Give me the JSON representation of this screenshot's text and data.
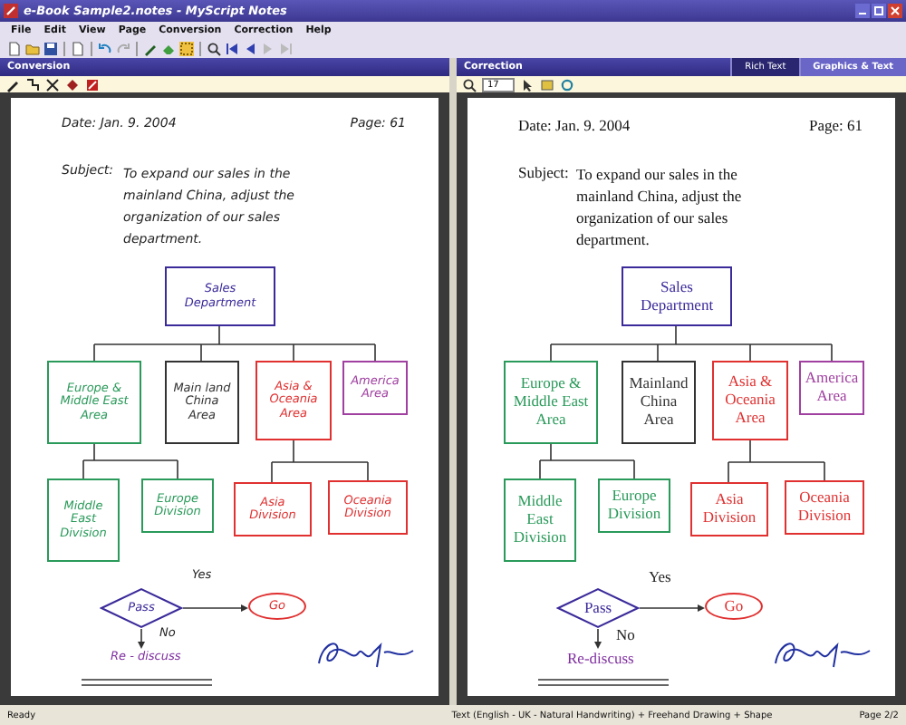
{
  "window": {
    "title": "e-Book Sample2.notes - MyScript Notes"
  },
  "menu": [
    "File",
    "Edit",
    "View",
    "Page",
    "Conversion",
    "Correction",
    "Help"
  ],
  "panes": [
    {
      "header": "Conversion",
      "kind": "handwritten",
      "page": {
        "date": "Date: Jan. 9. 2004",
        "page_no": "Page: 61",
        "subject_label": "Subject:",
        "subject_lines": [
          "To expand our sales in the",
          "mainland China, adjust the",
          "organization of our sales",
          "department."
        ],
        "nodes": [
          {
            "kind": "box",
            "lines": [
              "Sales",
              "Department"
            ],
            "color": "#3a2a9a"
          },
          {
            "kind": "box",
            "lines": [
              "Europe &",
              "Middle East",
              "Area"
            ],
            "color": "#2a9a5a"
          },
          {
            "kind": "box",
            "lines": [
              "Main land",
              "China",
              "Area"
            ],
            "color": "#333333"
          },
          {
            "kind": "box",
            "lines": [
              "Asia &",
              "Oceania",
              "Area"
            ],
            "color": "#e03030"
          },
          {
            "kind": "box",
            "lines": [
              "America",
              "Area"
            ],
            "color": "#a040a0"
          },
          {
            "kind": "box",
            "lines": [
              "Middle",
              "East",
              "Division"
            ],
            "color": "#2a9a5a"
          },
          {
            "kind": "box",
            "lines": [
              "Europe",
              "Division"
            ],
            "color": "#2a9a5a"
          },
          {
            "kind": "box",
            "lines": [
              "Asia",
              "Division"
            ],
            "color": "#e03030"
          },
          {
            "kind": "box",
            "lines": [
              "Oceania",
              "Division"
            ],
            "color": "#e03030"
          },
          {
            "kind": "diamond",
            "lines": [
              "Pass"
            ],
            "color": "#3a2a9a"
          },
          {
            "kind": "ellipse",
            "lines": [
              "Go"
            ],
            "color": "#e03030"
          },
          {
            "kind": "label",
            "lines": [
              "Yes"
            ],
            "color": "#222222"
          },
          {
            "kind": "label",
            "lines": [
              "No"
            ],
            "color": "#222222"
          },
          {
            "kind": "label",
            "lines": [
              "Re - discuss"
            ],
            "color": "#8030a0"
          }
        ]
      }
    },
    {
      "header": "Correction",
      "kind": "typed",
      "zoom_value": "17",
      "tabs": [
        {
          "label": "Rich Text",
          "selected": false
        },
        {
          "label": "Graphics & Text",
          "selected": true
        }
      ],
      "page": {
        "date": "Date: Jan. 9. 2004",
        "page_no": "Page: 61",
        "subject_label": "Subject:",
        "subject_lines": [
          "To expand our sales in the",
          "mainland China, adjust the",
          "organization of our sales",
          "department."
        ],
        "nodes": [
          {
            "kind": "box",
            "lines": [
              "Sales",
              "Department"
            ],
            "color": "#3a2a9a"
          },
          {
            "kind": "box",
            "lines": [
              "Europe &",
              "Middle East",
              "Area"
            ],
            "color": "#2a9a5a"
          },
          {
            "kind": "box",
            "lines": [
              "Mainland",
              "China",
              "Area"
            ],
            "color": "#333333"
          },
          {
            "kind": "box",
            "lines": [
              "Asia &",
              "Oceania",
              "Area"
            ],
            "color": "#e03030"
          },
          {
            "kind": "box",
            "lines": [
              "America",
              "Area"
            ],
            "color": "#a040a0"
          },
          {
            "kind": "box",
            "lines": [
              "Middle",
              "East",
              "Division"
            ],
            "color": "#2a9a5a"
          },
          {
            "kind": "box",
            "lines": [
              "Europe",
              "Division"
            ],
            "color": "#2a9a5a"
          },
          {
            "kind": "box",
            "lines": [
              "Asia",
              "Division"
            ],
            "color": "#e03030"
          },
          {
            "kind": "box",
            "lines": [
              "Oceania",
              "Division"
            ],
            "color": "#e03030"
          },
          {
            "kind": "diamond",
            "lines": [
              "Pass"
            ],
            "color": "#3a2a9a"
          },
          {
            "kind": "ellipse",
            "lines": [
              "Go"
            ],
            "color": "#e03030"
          },
          {
            "kind": "label",
            "lines": [
              "Yes"
            ],
            "color": "#222222"
          },
          {
            "kind": "label",
            "lines": [
              "No"
            ],
            "color": "#222222"
          },
          {
            "kind": "label",
            "lines": [
              "Re-discuss"
            ],
            "color": "#8030a0"
          }
        ]
      }
    }
  ],
  "status_bar": {
    "left": "Ready",
    "middle": "Text (English - UK - Natural Handwriting) + Freehand Drawing + Shape",
    "right": "Page 2/2"
  }
}
